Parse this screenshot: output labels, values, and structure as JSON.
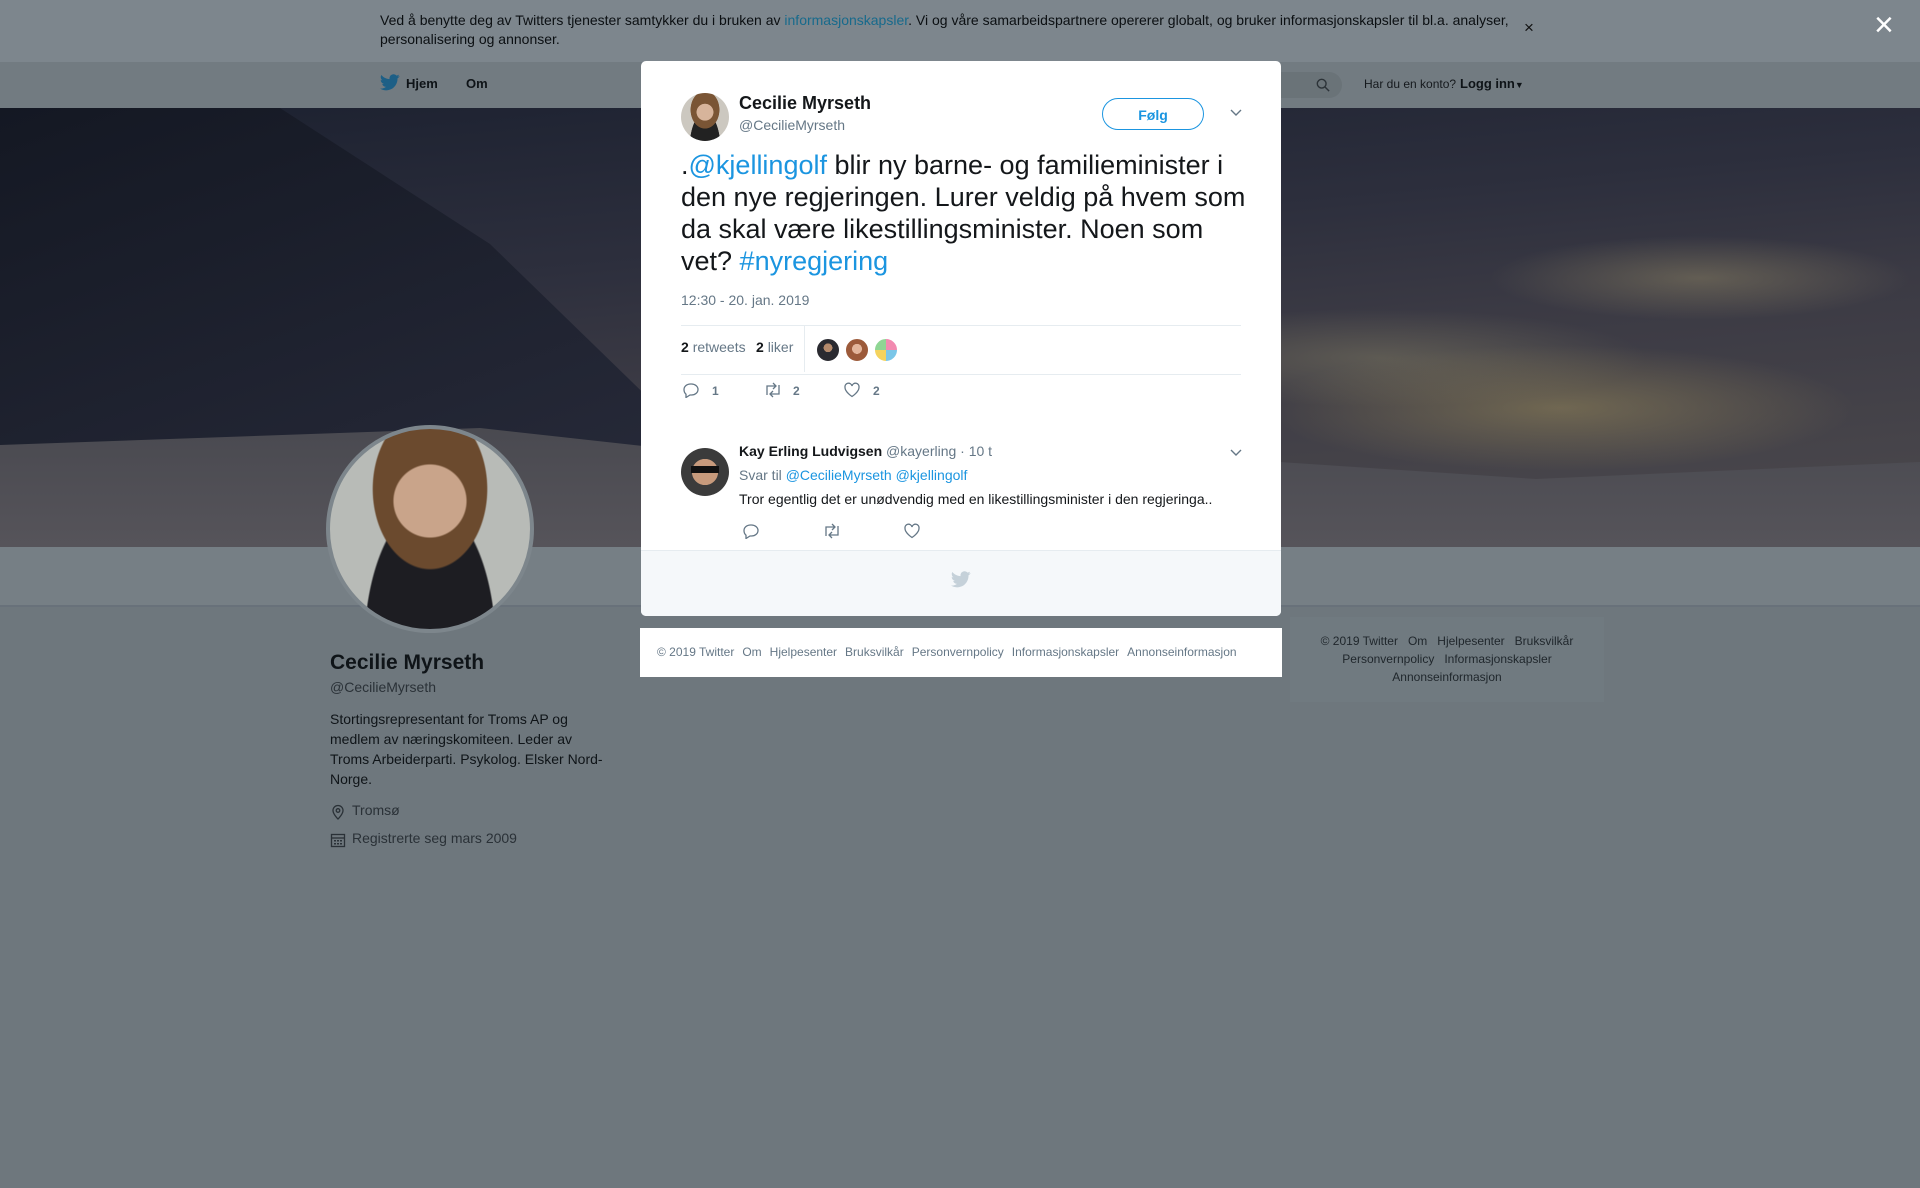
{
  "cookie_banner": {
    "text_before": "Ved å benytte deg av Twitters tjenester samtykker du i bruken av ",
    "link": "informasjonskapsler",
    "text_after": ". Vi og våre samarbeidspartnere opererer globalt, og bruker informasjonskapsler til bl.a. analyser, personalisering og annonser.",
    "close": "×"
  },
  "overlay_close": "×",
  "nav": {
    "home": "Hjem",
    "about": "Om",
    "account_question": "Har du en konto?",
    "login": "Logg inn"
  },
  "profile": {
    "name": "Cecilie Myrseth",
    "handle": "@CecilieMyrseth",
    "bio": "Stortingsrepresentant for Troms AP og medlem av næringskomiteen. Leder av Troms Arbeiderparti. Psykolog. Elsker Nord-Norge.",
    "location": "Tromsø",
    "joined": "Registrerte seg mars 2009"
  },
  "right_footer": {
    "links": [
      "© 2019 Twitter",
      "Om",
      "Hjelpesenter",
      "Bruksvilkår",
      "Personvernpolicy",
      "Informasjonskapsler",
      "Annonseinformasjon"
    ]
  },
  "tweet": {
    "author_name": "Cecilie Myrseth",
    "author_handle": "@CecilieMyrseth",
    "follow": "Følg",
    "text_prefix": ".",
    "mention": "@kjellingolf",
    "text_main": " blir ny barne- og familieminister i den nye regjeringen. Lurer veldig på hvem som da skal være likestillingsminister. Noen som vet? ",
    "hashtag": "#nyregjering",
    "timestamp": "12:30 - 20. jan. 2019",
    "retweets_count": "2",
    "retweets_label": "retweets",
    "likes_count": "2",
    "likes_label": "liker",
    "actions": {
      "replies": "1",
      "retweets": "2",
      "likes": "2"
    }
  },
  "reply": {
    "name": "Kay Erling Ludvigsen",
    "handle": "@kayerling",
    "time": "· 10 t",
    "reply_to_label": "Svar til",
    "reply_to_1": "@CecilieMyrseth",
    "reply_to_2": "@kjellingolf",
    "text": "Tror egentlig det er unødvendig med en likestillingsminister i den regjeringa.."
  },
  "modal_footer_links": [
    "© 2019 Twitter",
    "Om",
    "Hjelpesenter",
    "Bruksvilkår",
    "Personvernpolicy",
    "Informasjonskapsler",
    "Annonseinformasjon"
  ],
  "colors": {
    "accent": "#1b95e0",
    "overlay": "#6e777d"
  }
}
